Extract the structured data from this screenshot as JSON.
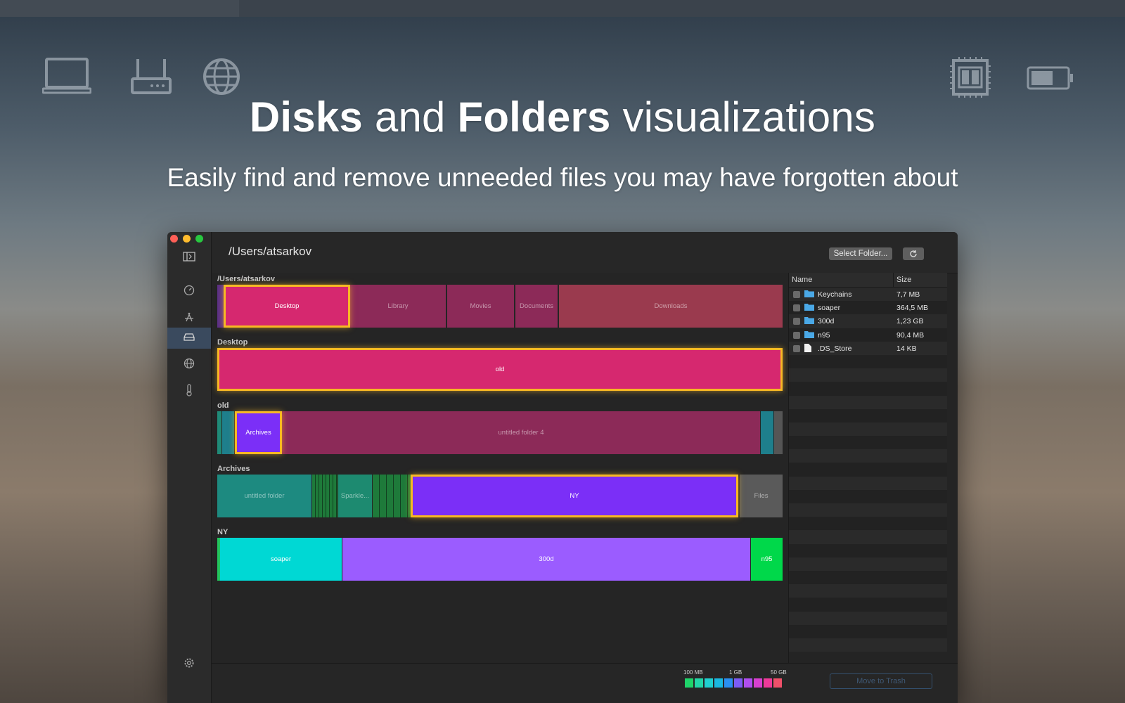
{
  "hero": {
    "title_bold1": "Disks",
    "title_mid": "and",
    "title_bold2": "Folders",
    "title_end": "visualizations",
    "subtitle": "Easily find and remove unneeded files you may have forgotten about",
    "icons": [
      "laptop-icon",
      "router-icon",
      "globe-icon",
      "cpu-icon",
      "battery-icon"
    ]
  },
  "window": {
    "path": "/Users/atsarkov",
    "select_folder_label": "Select Folder...",
    "refresh_icon": "refresh-icon",
    "sidebar_icons": [
      "sidebar-toggle-icon",
      "speedometer-icon",
      "app-store-icon",
      "disk-icon",
      "globe-icon",
      "thermometer-icon",
      "gear-icon"
    ],
    "traffic_colors": [
      "#ff5f57",
      "#febc2e",
      "#28c840"
    ]
  },
  "levels": [
    {
      "label": "/Users/atsarkov",
      "segments": [
        {
          "label": "",
          "color": "#5b2f86"
        },
        {
          "label": "Desktop",
          "color": "#d6286f",
          "highlight": true
        },
        {
          "label": "Library",
          "color": "#8c2a58"
        },
        {
          "label": "Movies",
          "color": "#8c2a58"
        },
        {
          "label": "Documents",
          "color": "#8c2a58"
        },
        {
          "label": "Downloads",
          "color": "#9a3a4e"
        }
      ]
    },
    {
      "label": "Desktop",
      "segments": [
        {
          "label": "old",
          "color": "#d6286f",
          "highlight": true
        }
      ]
    },
    {
      "label": "old",
      "segments": [
        {
          "label": "",
          "color": "#1f8a78"
        },
        {
          "label": "",
          "color": "#1e7f8c"
        },
        {
          "label": "Archives",
          "color": "#7b2ff7",
          "highlight": true
        },
        {
          "label": "untitled folder 4",
          "color": "#8c2a58"
        },
        {
          "label": "",
          "color": "#1e7f8c"
        },
        {
          "label": "",
          "color": "#555555"
        }
      ]
    },
    {
      "label": "Archives",
      "segments": [
        {
          "label": "untitled folder",
          "color": "#1d8a80"
        },
        {
          "label": "",
          "color": "#1e7a3a"
        },
        {
          "label": "Sparkle...",
          "color": "#1d8a70"
        },
        {
          "label": "",
          "color": "#1e7a3a"
        },
        {
          "label": "NY",
          "color": "#7b2ff7",
          "highlight": true
        },
        {
          "label": "Files",
          "color": "#5a5a5a"
        }
      ]
    },
    {
      "label": "NY",
      "segments": [
        {
          "label": "",
          "color": "#22c55e"
        },
        {
          "label": "soaper",
          "color": "#00d8d4",
          "bright": true
        },
        {
          "label": "300d",
          "color": "#9b5cff",
          "bright": true
        },
        {
          "label": "n95",
          "color": "#00d84a",
          "bright": true
        }
      ]
    }
  ],
  "file_list": {
    "columns": [
      "Name",
      "Size"
    ],
    "rows": [
      {
        "name": "Keychains",
        "size": "7,7 MB",
        "type": "folder"
      },
      {
        "name": "soaper",
        "size": "364,5 MB",
        "type": "folder"
      },
      {
        "name": "300d",
        "size": "1,23 GB",
        "type": "folder"
      },
      {
        "name": "n95",
        "size": "90,4 MB",
        "type": "folder"
      },
      {
        "name": ".DS_Store",
        "size": "14 KB",
        "type": "file"
      }
    ],
    "empty_rows": 22
  },
  "footer": {
    "legend_labels": [
      "100 MB",
      "1 GB",
      "50 GB"
    ],
    "legend_colors": [
      "#1fd46a",
      "#22d6a8",
      "#20d0d0",
      "#1ab8e0",
      "#2a8ff0",
      "#7c5cf4",
      "#b04ef0",
      "#d840d0",
      "#ee3a9a",
      "#f0506a"
    ],
    "move_to_trash_label": "Move to Trash"
  }
}
